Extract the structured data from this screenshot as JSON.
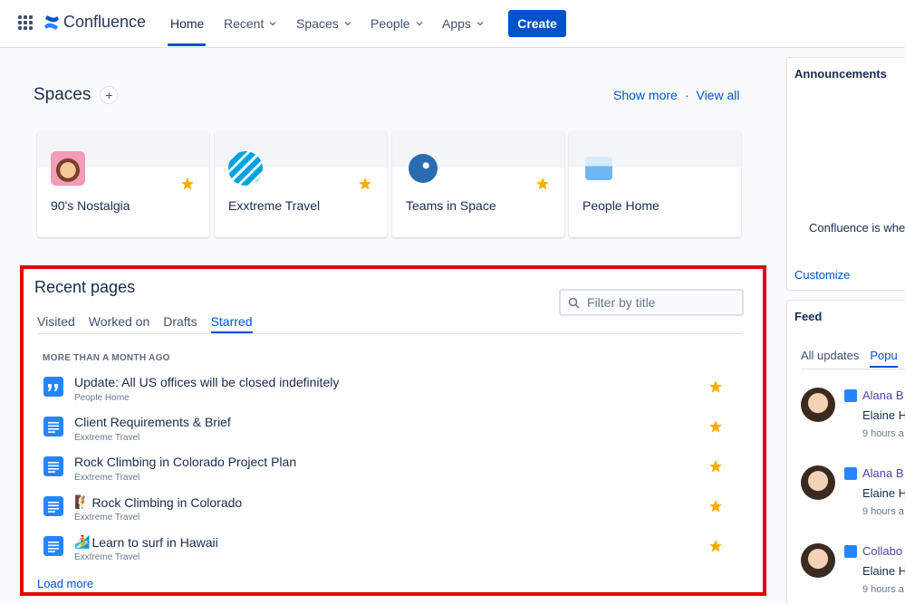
{
  "nav": {
    "app_name": "Confluence",
    "items": [
      {
        "label": "Home"
      },
      {
        "label": "Recent"
      },
      {
        "label": "Spaces"
      },
      {
        "label": "People"
      },
      {
        "label": "Apps"
      }
    ],
    "create_label": "Create"
  },
  "spaces": {
    "title": "Spaces",
    "show_more": "Show more",
    "separator": "·",
    "view_all": "View all",
    "cards": [
      {
        "name": "90's Nostalgia",
        "icon": "nostalgia-avatar-icon"
      },
      {
        "name": "Exxtreme Travel",
        "icon": "travel-avatar-icon"
      },
      {
        "name": "Teams in Space",
        "icon": "rocket-avatar-icon"
      },
      {
        "name": "People Home",
        "icon": "people-avatar-icon"
      }
    ]
  },
  "recent": {
    "title": "Recent pages",
    "filter_placeholder": "Filter by title",
    "tabs": [
      {
        "label": "Visited"
      },
      {
        "label": "Worked on"
      },
      {
        "label": "Drafts"
      },
      {
        "label": "Starred"
      }
    ],
    "group_label": "MORE THAN A MONTH AGO",
    "pages": [
      {
        "title": "Update: All US offices will be closed indefinitely",
        "space": "People Home",
        "type": "blog"
      },
      {
        "title": "Client Requirements & Brief",
        "space": "Exxtreme Travel",
        "type": "page"
      },
      {
        "title": "Rock Climbing in Colorado Project Plan",
        "space": "Exxtreme Travel",
        "type": "page"
      },
      {
        "title": "Rock Climbing in Colorado",
        "space": "Exxtreme Travel",
        "type": "page",
        "emoji": "🧗"
      },
      {
        "title": "Learn to surf in Hawaii",
        "space": "Exxtreme Travel",
        "type": "page",
        "emoji": "🏄"
      }
    ],
    "load_more": "Load more"
  },
  "rail": {
    "announcements_title": "Announcements",
    "announcement_text": "Confluence is whe",
    "customize": "Customize",
    "feed_title": "Feed",
    "feed_tabs": [
      {
        "label": "All updates"
      },
      {
        "label": "Popu"
      }
    ],
    "feed_items": [
      {
        "title": "Alana B",
        "sub": "Elaine H",
        "time": "9 hours a"
      },
      {
        "title": "Alana B",
        "sub": "Elaine H",
        "time": "9 hours a"
      },
      {
        "title": "Collabo",
        "sub": "Elaine H",
        "time": "9 hours a"
      }
    ]
  },
  "colors": {
    "accent": "#0052CC",
    "star": "#FFAB00",
    "highlight_border": "#E60000"
  }
}
